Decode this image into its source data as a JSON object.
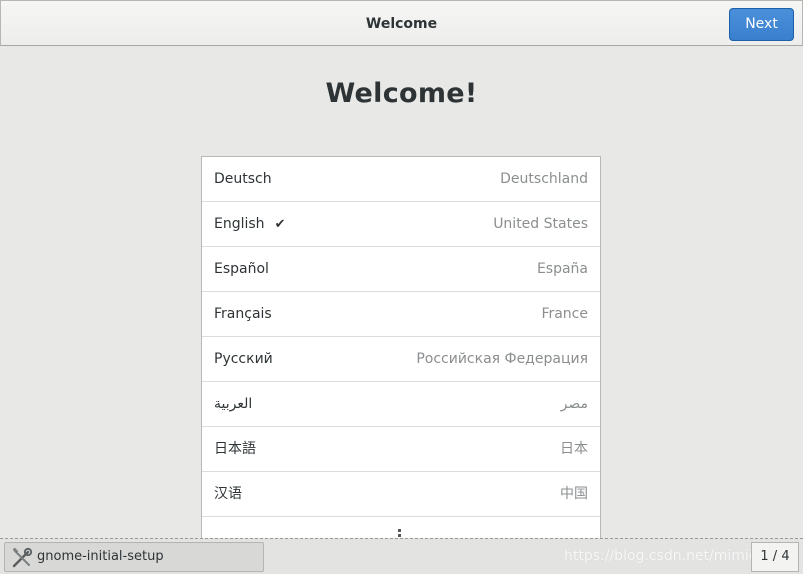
{
  "header": {
    "title": "Welcome",
    "next_label": "Next"
  },
  "main": {
    "heading": "Welcome!",
    "languages": [
      {
        "name": "Deutsch",
        "region": "Deutschland",
        "selected": false
      },
      {
        "name": "English",
        "region": "United States",
        "selected": true
      },
      {
        "name": "Español",
        "region": "España",
        "selected": false
      },
      {
        "name": "Français",
        "region": "France",
        "selected": false
      },
      {
        "name": "Русский",
        "region": "Российская Федерация",
        "selected": false
      },
      {
        "name": "العربية",
        "region": "مصر",
        "selected": false
      },
      {
        "name": "日本語",
        "region": "日本",
        "selected": false
      },
      {
        "name": "汉语",
        "region": "中国",
        "selected": false
      }
    ],
    "selected_mark": "✔"
  },
  "taskbar": {
    "app_label": "gnome-initial-setup",
    "app_icon": "tools-icon",
    "watermark": "https://blog.csdn.net/mimicoa",
    "workspace": "1 / 4"
  },
  "colors": {
    "accent": "#3a7fcf",
    "background": "#e8e8e7",
    "text": "#2e3436",
    "secondary_text": "#8b8e8f"
  }
}
